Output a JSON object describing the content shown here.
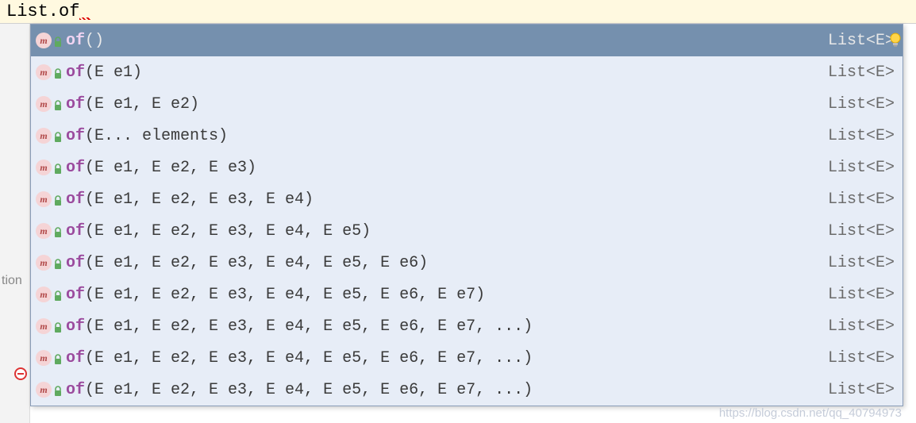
{
  "editor": {
    "text": "List.of"
  },
  "popup": {
    "items": [
      {
        "name": "of",
        "params": "()",
        "returnType": "List<E>",
        "selected": true,
        "lockColor": "#5faa5f"
      },
      {
        "name": "of",
        "params": "(E e1)",
        "returnType": "List<E>",
        "selected": false,
        "lockColor": "#5faa5f"
      },
      {
        "name": "of",
        "params": "(E e1, E e2)",
        "returnType": "List<E>",
        "selected": false,
        "lockColor": "#5faa5f"
      },
      {
        "name": "of",
        "params": "(E... elements)",
        "returnType": "List<E>",
        "selected": false,
        "lockColor": "#5faa5f"
      },
      {
        "name": "of",
        "params": "(E e1, E e2, E e3)",
        "returnType": "List<E>",
        "selected": false,
        "lockColor": "#5faa5f"
      },
      {
        "name": "of",
        "params": "(E e1, E e2, E e3, E e4)",
        "returnType": "List<E>",
        "selected": false,
        "lockColor": "#5faa5f"
      },
      {
        "name": "of",
        "params": "(E e1, E e2, E e3, E e4, E e5)",
        "returnType": "List<E>",
        "selected": false,
        "lockColor": "#5faa5f"
      },
      {
        "name": "of",
        "params": "(E e1, E e2, E e3, E e4, E e5, E e6)",
        "returnType": "List<E>",
        "selected": false,
        "lockColor": "#5faa5f"
      },
      {
        "name": "of",
        "params": "(E e1, E e2, E e3, E e4, E e5, E e6, E e7)",
        "returnType": "List<E>",
        "selected": false,
        "lockColor": "#5faa5f"
      },
      {
        "name": "of",
        "params": "(E e1, E e2, E e3, E e4, E e5, E e6, E e7, ...)",
        "returnType": "List<E>",
        "selected": false,
        "lockColor": "#5faa5f"
      },
      {
        "name": "of",
        "params": "(E e1, E e2, E e3, E e4, E e5, E e6, E e7, ...)",
        "returnType": "List<E>",
        "selected": false,
        "lockColor": "#5faa5f"
      },
      {
        "name": "of",
        "params": "(E e1, E e2, E e3, E e4, E e5, E e6, E e7, ...)",
        "returnType": "List<E>",
        "selected": false,
        "lockColor": "#5faa5f"
      }
    ]
  },
  "gutter": {
    "leftText": "tion"
  },
  "watermark": "https://blog.csdn.net/qq_40794973"
}
